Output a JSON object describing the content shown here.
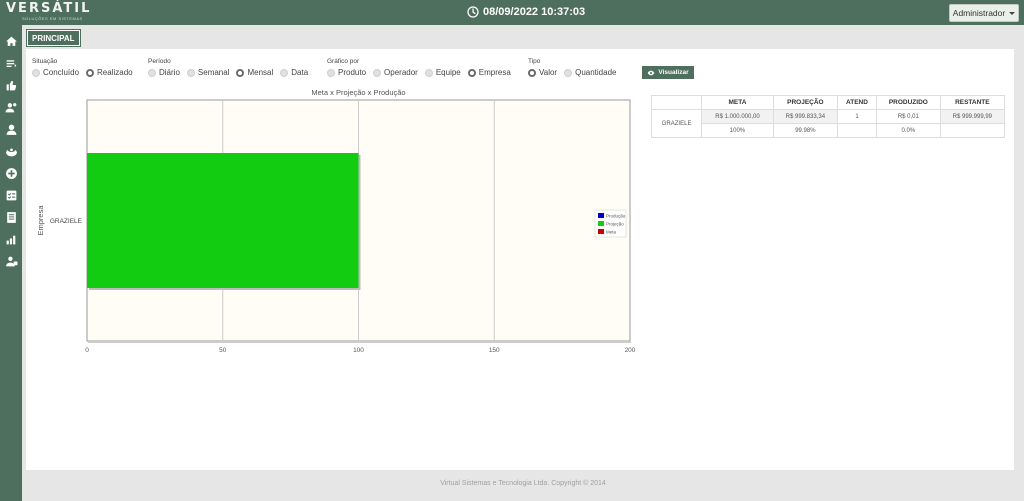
{
  "header": {
    "logo_text": "VERSÁTIL",
    "logo_subtext": "SOLUÇÕES EM SISTEMAS",
    "datetime": "08/09/2022 10:37:03",
    "user_menu": "Administrador"
  },
  "sidebar": {
    "icons": [
      "home-icon",
      "list-icon",
      "thumbs-up-icon",
      "user-group-icon",
      "user-icon",
      "coins-icon",
      "plus-circle-icon",
      "checklist-icon",
      "document-icon",
      "bar-chart-icon",
      "users-icon"
    ]
  },
  "page": {
    "tag": "PRINCIPAL"
  },
  "filters": {
    "situacao": {
      "title": "Situação",
      "options": [
        {
          "label": "Concluído",
          "selected": false
        },
        {
          "label": "Realizado",
          "selected": true
        }
      ]
    },
    "periodo": {
      "title": "Período",
      "options": [
        {
          "label": "Diário",
          "selected": false
        },
        {
          "label": "Semanal",
          "selected": false
        },
        {
          "label": "Mensal",
          "selected": true
        },
        {
          "label": "Data",
          "selected": false
        }
      ]
    },
    "grafico": {
      "title": "Gráfico por",
      "options": [
        {
          "label": "Produto",
          "selected": false
        },
        {
          "label": "Operador",
          "selected": false
        },
        {
          "label": "Equipe",
          "selected": false
        },
        {
          "label": "Empresa",
          "selected": true
        }
      ]
    },
    "tipo": {
      "title": "Tipo",
      "options": [
        {
          "label": "Valor",
          "selected": true
        },
        {
          "label": "Quantidade",
          "selected": false
        }
      ]
    },
    "button": "Visualizar"
  },
  "chart_data": {
    "type": "bar",
    "orientation": "horizontal",
    "title": "Meta x Projeção x Produção",
    "ylabel": "Empresa",
    "categories": [
      "GRAZIELE"
    ],
    "series": [
      {
        "name": "Produção",
        "values": [
          0
        ],
        "color": "#0000cc"
      },
      {
        "name": "Projeção",
        "values": [
          100
        ],
        "color": "#11cc11"
      },
      {
        "name": "Meta",
        "values": [
          0
        ],
        "color": "#cc0000"
      }
    ],
    "xlim": [
      0,
      200
    ],
    "xticks": [
      "0",
      "50",
      "100",
      "150",
      "200"
    ],
    "grid": true,
    "legend": "right",
    "background": "#fffdf5"
  },
  "summary_table": {
    "headers": [
      "",
      "META",
      "PROJEÇÃO",
      "ATEND",
      "PRODUZIDO",
      "RESTANTE"
    ],
    "row_label": "GRAZIELE",
    "values": [
      "R$ 1.000.000,00",
      "R$ 999.833,34",
      "1",
      "R$ 0,01",
      "R$ 999.999,99"
    ],
    "percents": [
      "100%",
      "99.98%",
      "",
      "0.0%",
      ""
    ]
  },
  "footer": "Virtual Sistemas e Tecnologia Ltda. Copyright © 2014",
  "colors": {
    "brand": "#4f6f5e",
    "panel_bg": "#ffffff",
    "page_bg": "#e6e6e6"
  }
}
